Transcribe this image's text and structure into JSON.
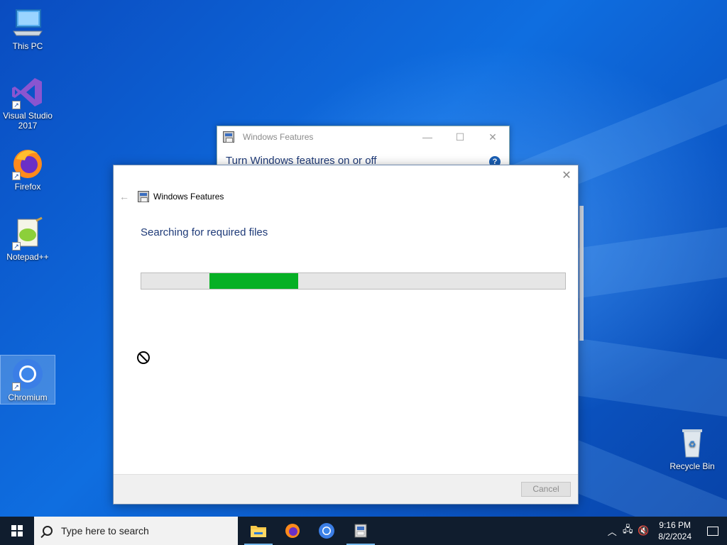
{
  "desktop": {
    "icons": [
      {
        "label": "This PC"
      },
      {
        "label": "Visual Studio\n2017"
      },
      {
        "label": "Firefox"
      },
      {
        "label": "Notepad++"
      },
      {
        "label": "Chromium"
      },
      {
        "label": "Recycle Bin"
      }
    ]
  },
  "bg_window": {
    "title": "Windows Features",
    "subtitle": "Turn Windows features on or off",
    "minimize": "—",
    "maximize": "☐",
    "close": "✕",
    "help": "?"
  },
  "dialog": {
    "back": "←",
    "title": "Windows Features",
    "close": "✕",
    "heading": "Searching for required files",
    "progress": {
      "start_fraction": 0.16,
      "end_fraction": 0.37,
      "color": "#06b025"
    },
    "cancel_label": "Cancel"
  },
  "taskbar": {
    "search_placeholder": "Type here to search",
    "apps": [
      "file-explorer",
      "firefox",
      "chromium",
      "windows-features"
    ],
    "tray": {
      "chevron": "︿",
      "network": "🖧",
      "volume": "🔇",
      "time": "9:16 PM",
      "date": "8/2/2024"
    }
  }
}
